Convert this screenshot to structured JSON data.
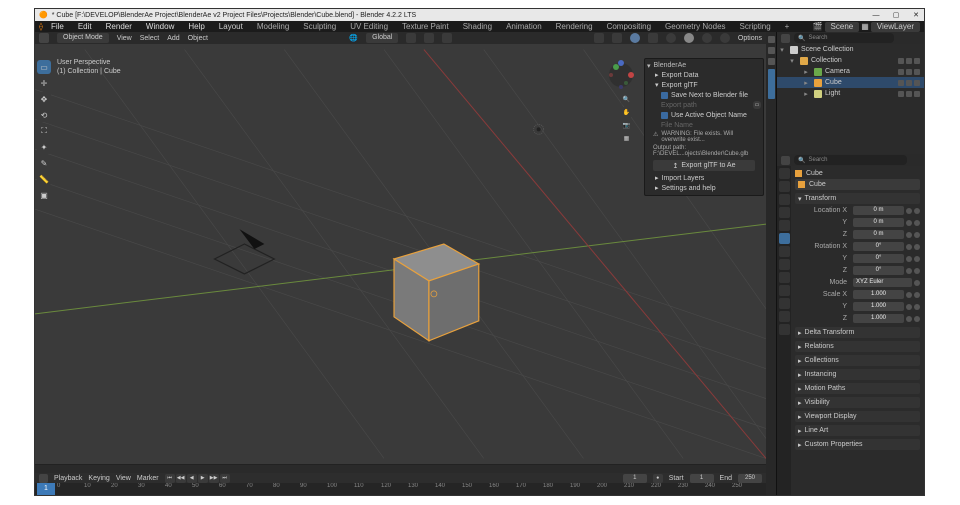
{
  "title": "* Cube [F:\\DEVELOP\\BlenderAe Project\\BlenderAe v2 Project Files\\Projects\\Blender\\Cube.blend] - Blender 4.2.2 LTS",
  "menubar": [
    "File",
    "Edit",
    "Render",
    "Window",
    "Help"
  ],
  "workspaces": [
    "Layout",
    "Modeling",
    "Sculpting",
    "UV Editing",
    "Texture Paint",
    "Shading",
    "Animation",
    "Rendering",
    "Compositing",
    "Geometry Nodes",
    "Scripting"
  ],
  "workspace_plus": "+",
  "hdr_scene": "Scene",
  "hdr_viewlayer": "ViewLayer",
  "vp_header": {
    "mode_icon": "object-mode-icon",
    "mode": "Object Mode",
    "menus": [
      "View",
      "Select",
      "Add",
      "Object"
    ],
    "orient": "Global",
    "options": "Options"
  },
  "overlay": {
    "line1": "User Perspective",
    "line2": "(1) Collection | Cube"
  },
  "npanel": {
    "title": "BlenderAe",
    "export_data": "Export Data",
    "export_gltf": "Export glTF",
    "save_next": "Save Next to Blender file",
    "export_path_label": "Export path",
    "use_active": "Use Active Object Name",
    "file_name_label": "File Name",
    "warn": "WARNING: File exists. Will overwrite exist...",
    "out_path": "Output path: F:\\DEVEL...ojects\\Blender\\Cube.glb",
    "btn_export": "Export glTF to Ae",
    "import_layers": "Import Layers",
    "settings": "Settings and help"
  },
  "outliner": {
    "search_ph": "Search",
    "root": "Scene Collection",
    "collection": "Collection",
    "items": [
      "Camera",
      "Cube",
      "Light"
    ]
  },
  "props": {
    "search_ph": "Search",
    "crumb1": "Cube",
    "crumb2": "Cube",
    "sections": {
      "transform": "Transform",
      "delta": "Delta Transform",
      "relations": "Relations",
      "collections": "Collections",
      "instancing": "Instancing",
      "motion": "Motion Paths",
      "visibility": "Visibility",
      "viewport": "Viewport Display",
      "lineart": "Line Art",
      "custom": "Custom Properties"
    },
    "loc_label": "Location X",
    "loc": [
      "0 m",
      "0 m",
      "0 m"
    ],
    "rot_label": "Rotation X",
    "rot": [
      "0°",
      "0°",
      "0°"
    ],
    "mode_label": "Mode",
    "mode_val": "XYZ Euler",
    "scale_label": "Scale X",
    "scale": [
      "1.000",
      "1.000",
      "1.000"
    ],
    "axis_yz": [
      "Y",
      "Z"
    ]
  },
  "timeline": {
    "playback": "Playback",
    "keying": "Keying",
    "view": "View",
    "marker": "Marker",
    "cur": "1",
    "start_lbl": "Start",
    "start": "1",
    "end_lbl": "End",
    "end": "250",
    "ticks": [
      0,
      10,
      20,
      30,
      40,
      50,
      60,
      70,
      80,
      90,
      100,
      110,
      120,
      130,
      140,
      150,
      160,
      170,
      180,
      190,
      200,
      210,
      220,
      230,
      240,
      250
    ]
  }
}
